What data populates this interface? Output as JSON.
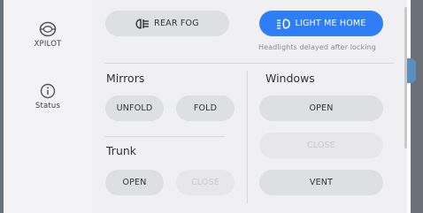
{
  "sidebar": {
    "items": [
      {
        "label": "XPILOT",
        "icon": "steering-wheel-icon"
      },
      {
        "label": "Status",
        "icon": "info-icon"
      }
    ]
  },
  "lights": {
    "rear_fog_label": "REAR FOG",
    "light_me_home_label": "LIGHT ME HOME",
    "light_me_home_caption": "Headlights delayed after locking"
  },
  "mirrors": {
    "title": "Mirrors",
    "unfold_label": "UNFOLD",
    "fold_label": "FOLD"
  },
  "windows": {
    "title": "Windows",
    "open_label": "OPEN",
    "close_label": "CLOSE",
    "vent_label": "VENT"
  },
  "trunk": {
    "title": "Trunk",
    "open_label": "OPEN",
    "close_label": "CLOSE"
  },
  "colors": {
    "accent": "#2e7ef7",
    "button_bg": "#dedfe3",
    "panel_bg": "#f0f0f2",
    "sidebar_bg": "#f3f3f5"
  }
}
